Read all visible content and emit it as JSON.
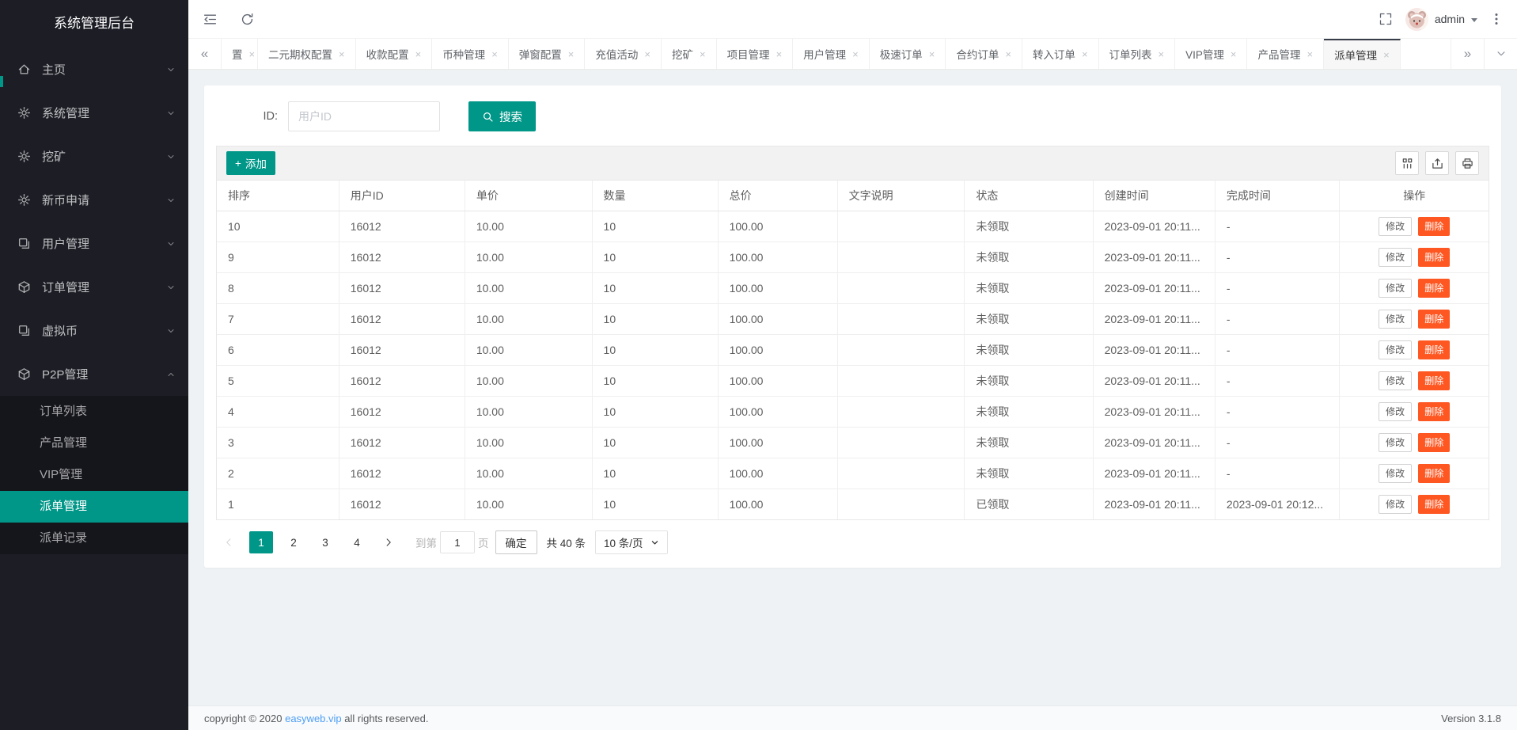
{
  "app": {
    "title": "系统管理后台"
  },
  "colors": {
    "accent": "#009688",
    "danger": "#FF5722",
    "sidebar_bg": "#1C1D25",
    "submenu_bg": "#15161C",
    "tab_active_border": "#373D49",
    "link_blue": "#4D9EF7"
  },
  "icons": {
    "scroll_left": "«",
    "scroll_right": "»",
    "close": "×",
    "plus": "+"
  },
  "header": {
    "user": "admin"
  },
  "sidebar": {
    "title": "系统管理后台",
    "items": [
      {
        "id": "home",
        "label": "主页",
        "icon": "home-icon"
      },
      {
        "id": "system",
        "label": "系统管理",
        "icon": "gear-icon"
      },
      {
        "id": "mining",
        "label": "挖矿",
        "icon": "mining-icon"
      },
      {
        "id": "new-coin",
        "label": "新币申请",
        "icon": "newcoin-icon"
      },
      {
        "id": "users",
        "label": "用户管理",
        "icon": "users-icon"
      },
      {
        "id": "orders",
        "label": "订单管理",
        "icon": "orders-icon"
      },
      {
        "id": "virtual-coin",
        "label": "虚拟币",
        "icon": "coin-icon"
      },
      {
        "id": "p2p",
        "label": "P2P管理",
        "icon": "p2p-icon",
        "expanded": true
      }
    ],
    "submenu": [
      {
        "id": "order-list",
        "label": "订单列表"
      },
      {
        "id": "product",
        "label": "产品管理"
      },
      {
        "id": "vip",
        "label": "VIP管理"
      },
      {
        "id": "dispatch",
        "label": "派单管理",
        "active": true
      },
      {
        "id": "dispatch-log",
        "label": "派单记录"
      }
    ]
  },
  "tabs": [
    {
      "label": "置",
      "clipped": true
    },
    {
      "label": "二元期权配置"
    },
    {
      "label": "收款配置"
    },
    {
      "label": "币种管理"
    },
    {
      "label": "弹窗配置"
    },
    {
      "label": "充值活动"
    },
    {
      "label": "挖矿"
    },
    {
      "label": "项目管理"
    },
    {
      "label": "用户管理"
    },
    {
      "label": "极速订单"
    },
    {
      "label": "合约订单"
    },
    {
      "label": "转入订单"
    },
    {
      "label": "订单列表"
    },
    {
      "label": "VIP管理"
    },
    {
      "label": "产品管理"
    },
    {
      "label": "派单管理",
      "active": true
    }
  ],
  "search": {
    "label": "ID:",
    "placeholder": "用户ID",
    "button": "搜索"
  },
  "toolbar": {
    "add": "添加"
  },
  "table": {
    "headers": [
      "排序",
      "用户ID",
      "单价",
      "数量",
      "总价",
      "文字说明",
      "状态",
      "创建时间",
      "完成时间",
      "操作"
    ],
    "actions": {
      "edit": "修改",
      "del": "删除"
    },
    "rows": [
      {
        "sort": "10",
        "user_id": "16012",
        "price": "10.00",
        "qty": "10",
        "total": "100.00",
        "desc": "",
        "status": "未领取",
        "created": "2023-09-01 20:11...",
        "finished": "-"
      },
      {
        "sort": "9",
        "user_id": "16012",
        "price": "10.00",
        "qty": "10",
        "total": "100.00",
        "desc": "",
        "status": "未领取",
        "created": "2023-09-01 20:11...",
        "finished": "-"
      },
      {
        "sort": "8",
        "user_id": "16012",
        "price": "10.00",
        "qty": "10",
        "total": "100.00",
        "desc": "",
        "status": "未领取",
        "created": "2023-09-01 20:11...",
        "finished": "-"
      },
      {
        "sort": "7",
        "user_id": "16012",
        "price": "10.00",
        "qty": "10",
        "total": "100.00",
        "desc": "",
        "status": "未领取",
        "created": "2023-09-01 20:11...",
        "finished": "-"
      },
      {
        "sort": "6",
        "user_id": "16012",
        "price": "10.00",
        "qty": "10",
        "total": "100.00",
        "desc": "",
        "status": "未领取",
        "created": "2023-09-01 20:11...",
        "finished": "-"
      },
      {
        "sort": "5",
        "user_id": "16012",
        "price": "10.00",
        "qty": "10",
        "total": "100.00",
        "desc": "",
        "status": "未领取",
        "created": "2023-09-01 20:11...",
        "finished": "-"
      },
      {
        "sort": "4",
        "user_id": "16012",
        "price": "10.00",
        "qty": "10",
        "total": "100.00",
        "desc": "",
        "status": "未领取",
        "created": "2023-09-01 20:11...",
        "finished": "-"
      },
      {
        "sort": "3",
        "user_id": "16012",
        "price": "10.00",
        "qty": "10",
        "total": "100.00",
        "desc": "",
        "status": "未领取",
        "created": "2023-09-01 20:11...",
        "finished": "-"
      },
      {
        "sort": "2",
        "user_id": "16012",
        "price": "10.00",
        "qty": "10",
        "total": "100.00",
        "desc": "",
        "status": "未领取",
        "created": "2023-09-01 20:11...",
        "finished": "-"
      },
      {
        "sort": "1",
        "user_id": "16012",
        "price": "10.00",
        "qty": "10",
        "total": "100.00",
        "desc": "",
        "status": "已领取",
        "created": "2023-09-01 20:11...",
        "finished": "2023-09-01 20:12..."
      }
    ]
  },
  "pagination": {
    "pages": [
      "1",
      "2",
      "3",
      "4"
    ],
    "active_page": "1",
    "goto_prefix": "到第",
    "page_input": "1",
    "goto_suffix": "页",
    "confirm": "确定",
    "total": "共 40 条",
    "per_page": "10 条/页"
  },
  "footer": {
    "copyright_prefix": "copyright © 2020 ",
    "copyright_link": "easyweb.vip",
    "copyright_suffix": " all rights reserved.",
    "version": "Version 3.1.8"
  }
}
